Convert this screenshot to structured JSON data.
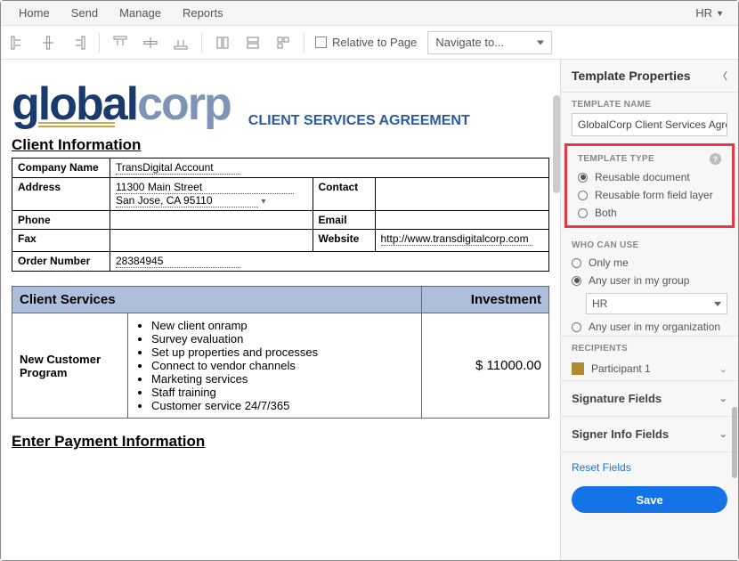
{
  "menu": {
    "home": "Home",
    "send": "Send",
    "manage": "Manage",
    "reports": "Reports",
    "user": "HR"
  },
  "toolbar": {
    "relative": "Relative to Page",
    "navigate": "Navigate to..."
  },
  "doc": {
    "logo_a": "global",
    "logo_b": "corp",
    "title": "CLIENT SERVICES AGREEMENT",
    "section_client": "Client Information",
    "labels": {
      "company": "Company Name",
      "address": "Address",
      "contact": "Contact",
      "phone": "Phone",
      "email": "Email",
      "fax": "Fax",
      "website": "Website",
      "order": "Order Number"
    },
    "values": {
      "company": "TransDigital Account",
      "addr1": "11300 Main Street",
      "addr2": "San Jose, CA  95110",
      "website": "http://www.transdigitalcorp.com",
      "order": "28384945"
    },
    "services_h1": "Client Services",
    "services_h2": "Investment",
    "program": "New Customer Program",
    "bullets": [
      "New client onramp",
      "Survey evaluation",
      "Set up properties and processes",
      "Connect to vendor channels",
      "Marketing services",
      "Staff training",
      "Customer service 24/7/365"
    ],
    "amount": "$ 11000.00",
    "section_pay": "Enter Payment Information"
  },
  "panel": {
    "title": "Template Properties",
    "tname_label": "TEMPLATE NAME",
    "tname_value": "GlobalCorp Client Services Agreement",
    "ttype_label": "TEMPLATE TYPE",
    "ttype_opts": [
      "Reusable document",
      "Reusable form field layer",
      "Both"
    ],
    "who_label": "WHO CAN USE",
    "who_opts": [
      "Only me",
      "Any user in my group",
      "Any user in my organization"
    ],
    "group": "HR",
    "recip_label": "RECIPIENTS",
    "recip_value": "Participant 1",
    "acc1": "Signature Fields",
    "acc2": "Signer Info Fields",
    "reset": "Reset Fields",
    "save": "Save"
  }
}
